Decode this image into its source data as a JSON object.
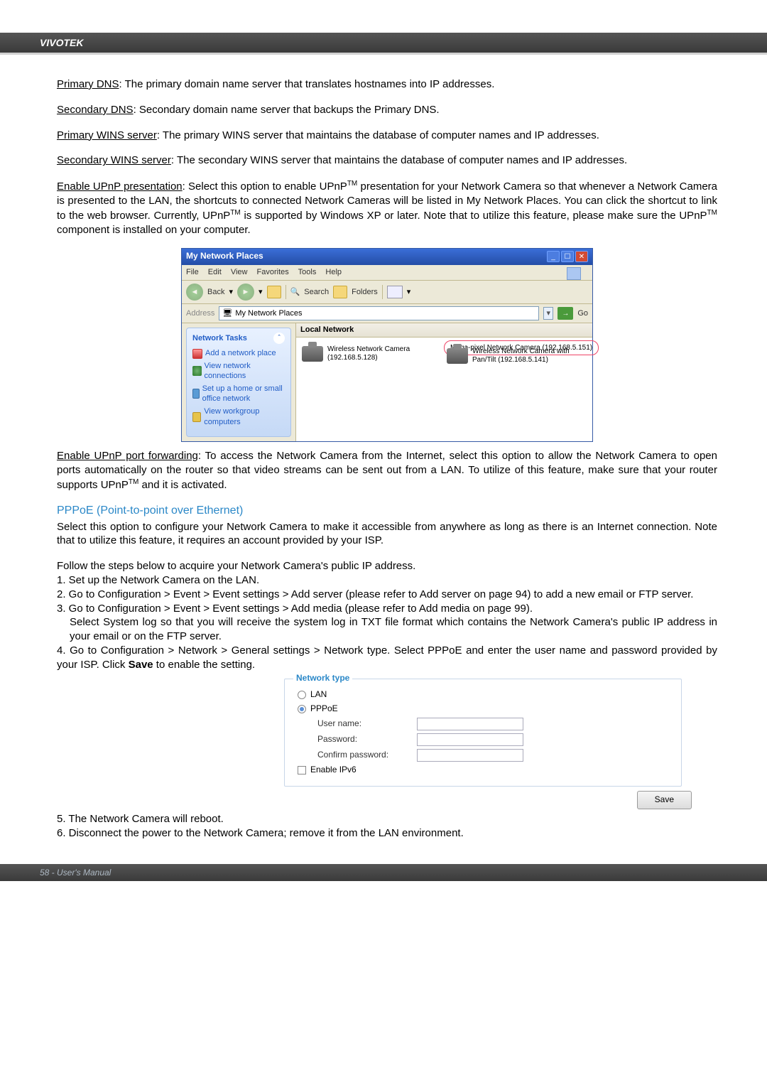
{
  "header": {
    "brand": "VIVOTEK"
  },
  "defs": {
    "primary_dns": {
      "term": "Primary DNS",
      "text": ": The primary domain name server that translates hostnames into IP addresses."
    },
    "secondary_dns": {
      "term": "Secondary DNS",
      "text": ": Secondary domain name server that backups the Primary DNS."
    },
    "primary_wins": {
      "term": "Primary WINS server",
      "text": ": The primary WINS server that maintains the database of computer names and IP addresses."
    },
    "secondary_wins": {
      "term": "Secondary WINS server",
      "text": ": The secondary WINS server that maintains the database of computer names and IP addresses."
    },
    "upnp_pres": {
      "term": "Enable UPnP presentation",
      "p1": ": Select this option to enable UPnP",
      "tm1": "TM",
      "p2": " presentation for your Network Camera so that whenever a Network Camera is presented to the LAN, the shortcuts to connected Network Cameras will be listed in My Network Places. You can click the shortcut to link to the web browser. Currently, UPnP",
      "tm2": "TM",
      "p3": " is supported by Windows XP or later. Note that to utilize this feature, please make sure the UPnP",
      "tm3": "TM",
      "p4": " component is installed on your computer."
    }
  },
  "netplaces": {
    "title": "My Network Places",
    "menus": [
      "File",
      "Edit",
      "View",
      "Favorites",
      "Tools",
      "Help"
    ],
    "back": "Back",
    "search": "Search",
    "folders": "Folders",
    "address_label": "Address",
    "address_value": "My Network Places",
    "go": "Go",
    "side_header": "Network Tasks",
    "tasks": [
      "Add a network place",
      "View network connections",
      "Set up a home or small office network",
      "View workgroup computers"
    ],
    "local_network": "Local Network",
    "items": [
      {
        "line1": "Wireless Network Camera",
        "line2": "(192.168.5.128)"
      },
      {
        "line1": "Wireless Network Camera with",
        "line2": "Pan/Tilt (192.168.5.141)"
      }
    ],
    "callout": "Mega-pixel Network Camera (192.168.5.151)"
  },
  "upnp_port": {
    "term": "Enable UPnP port forwarding",
    "p1": ": To access the Network Camera from the Internet, select this option to allow the Network Camera to open ports automatically on the router so that video streams can be sent out from a LAN. To utilize of this feature, make sure that your router supports UPnP",
    "tm": "TM",
    "p2": " and it is activated."
  },
  "pppoe": {
    "heading": "PPPoE (Point-to-point over Ethernet)",
    "intro": "Select this option to configure your Network Camera to make it accessible from anywhere as long as there is an Internet connection. Note that to utilize this feature, it requires an account provided by your ISP.",
    "follow": "Follow the steps below to acquire your Network Camera's public IP address.",
    "step1": "1. Set up the Network Camera on the LAN.",
    "step2": "2. Go to Configuration > Event > Event settings > Add server (please refer to Add server on page 94) to add a new email or FTP server.",
    "step3a": "3. Go to Configuration > Event > Event settings > Add media (please refer to Add media on page 99).",
    "step3b": "Select System log so that you will receive the system log in TXT file format which contains the Network Camera's public IP address in your email or on the FTP server.",
    "step4a": "4. Go to Configuration > Network > General settings > Network type. Select PPPoE and enter the user name and password provided by your ISP. Click ",
    "step4_save": "Save",
    "step4b": " to enable the setting."
  },
  "nettype": {
    "legend": "Network type",
    "lan": "LAN",
    "pppoe": "PPPoE",
    "username": "User name:",
    "password": "Password:",
    "confirm": "Confirm password:",
    "enable_ipv6": "Enable IPv6",
    "save_btn": "Save"
  },
  "post_steps": {
    "step5": "5. The Network Camera will reboot.",
    "step6": "6. Disconnect the power to the Network Camera; remove it from the LAN environment."
  },
  "footer": {
    "text": "58 - User's Manual"
  }
}
